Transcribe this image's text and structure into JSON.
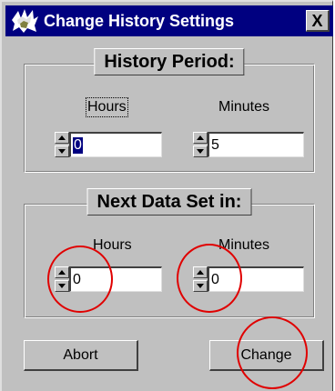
{
  "window": {
    "title": "Change History Settings",
    "close_label": "X",
    "icon": "app-icon"
  },
  "history_period": {
    "title": "History Period:",
    "hours_label": "Hours",
    "minutes_label": "Minutes",
    "hours_value": "0",
    "minutes_value": "5"
  },
  "next_data_set": {
    "title": "Next Data Set in:",
    "hours_label": "Hours",
    "minutes_label": "Minutes",
    "hours_value": "0",
    "minutes_value": "0"
  },
  "buttons": {
    "abort_label": "Abort",
    "change_label": "Change"
  },
  "colors": {
    "titlebar": "#000080",
    "face": "#c0c0c0",
    "annotation": "#e00000"
  }
}
